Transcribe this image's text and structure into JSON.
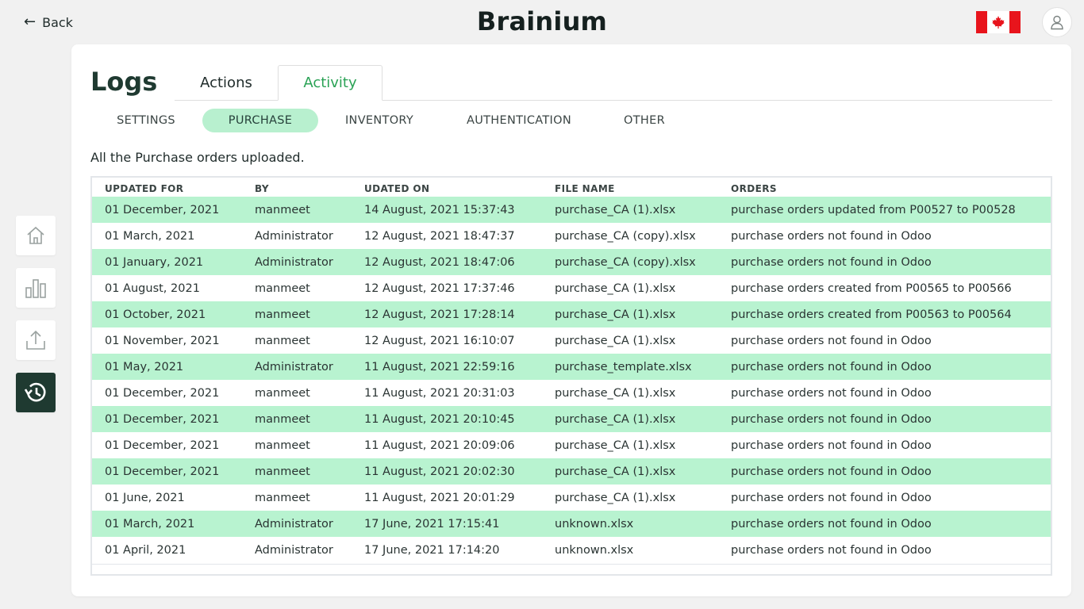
{
  "header": {
    "back_label": "Back",
    "brand": "Brainium",
    "flag_icon": "canada-flag-icon",
    "avatar_icon": "user-icon"
  },
  "sidebar": {
    "items": [
      {
        "icon": "home-icon",
        "active": false
      },
      {
        "icon": "bar-chart-icon",
        "active": false
      },
      {
        "icon": "upload-icon",
        "active": false
      },
      {
        "icon": "history-icon",
        "active": true
      }
    ]
  },
  "page": {
    "title": "Logs",
    "tabs": [
      {
        "label": "Actions",
        "active": false
      },
      {
        "label": "Activity",
        "active": true
      }
    ],
    "subtabs": [
      {
        "label": "SETTINGS",
        "active": false
      },
      {
        "label": "PURCHASE",
        "active": true
      },
      {
        "label": "INVENTORY",
        "active": false
      },
      {
        "label": "AUTHENTICATION",
        "active": false
      },
      {
        "label": "OTHER",
        "active": false
      }
    ],
    "description": "All the Purchase orders uploaded."
  },
  "table": {
    "columns": [
      "UPDATED FOR",
      "BY",
      "UDATED ON",
      "FILE NAME",
      "ORDERS"
    ],
    "rows": [
      [
        "01 December, 2021",
        "manmeet",
        "14 August, 2021 15:37:43",
        "purchase_CA (1).xlsx",
        "purchase orders updated from P00527 to P00528"
      ],
      [
        "01 March, 2021",
        "Administrator",
        "12 August, 2021 18:47:37",
        "purchase_CA (copy).xlsx",
        "purchase orders not found in Odoo"
      ],
      [
        "01 January, 2021",
        "Administrator",
        "12 August, 2021 18:47:06",
        "purchase_CA (copy).xlsx",
        "purchase orders not found in Odoo"
      ],
      [
        "01 August, 2021",
        "manmeet",
        "12 August, 2021 17:37:46",
        "purchase_CA (1).xlsx",
        "purchase orders created from P00565 to P00566"
      ],
      [
        "01 October, 2021",
        "manmeet",
        "12 August, 2021 17:28:14",
        "purchase_CA (1).xlsx",
        "purchase orders created from P00563 to P00564"
      ],
      [
        "01 November, 2021",
        "manmeet",
        "12 August, 2021 16:10:07",
        "purchase_CA (1).xlsx",
        "purchase orders not found in Odoo"
      ],
      [
        "01 May, 2021",
        "Administrator",
        "11 August, 2021 22:59:16",
        "purchase_template.xlsx",
        "purchase orders not found in Odoo"
      ],
      [
        "01 December, 2021",
        "manmeet",
        "11 August, 2021 20:31:03",
        "purchase_CA (1).xlsx",
        "purchase orders not found in Odoo"
      ],
      [
        "01 December, 2021",
        "manmeet",
        "11 August, 2021 20:10:45",
        "purchase_CA (1).xlsx",
        "purchase orders not found in Odoo"
      ],
      [
        "01 December, 2021",
        "manmeet",
        "11 August, 2021 20:09:06",
        "purchase_CA (1).xlsx",
        "purchase orders not found in Odoo"
      ],
      [
        "01 December, 2021",
        "manmeet",
        "11 August, 2021 20:02:30",
        "purchase_CA (1).xlsx",
        "purchase orders not found in Odoo"
      ],
      [
        "01 June, 2021",
        "manmeet",
        "11 August, 2021 20:01:29",
        "purchase_CA (1).xlsx",
        "purchase orders not found in Odoo"
      ],
      [
        "01 March, 2021",
        "Administrator",
        "17 June, 2021 17:15:41",
        "unknown.xlsx",
        "purchase orders not found in Odoo"
      ],
      [
        "01 April, 2021",
        "Administrator",
        "17 June, 2021 17:14:20",
        "unknown.xlsx",
        "purchase orders not found in Odoo"
      ]
    ]
  },
  "colors": {
    "accent_green": "#2aa255",
    "row_highlight": "#b8f3d0",
    "pill_active": "#b8f0cf",
    "sidebar_active": "#1f3a31",
    "flag_red": "#e8141c"
  }
}
